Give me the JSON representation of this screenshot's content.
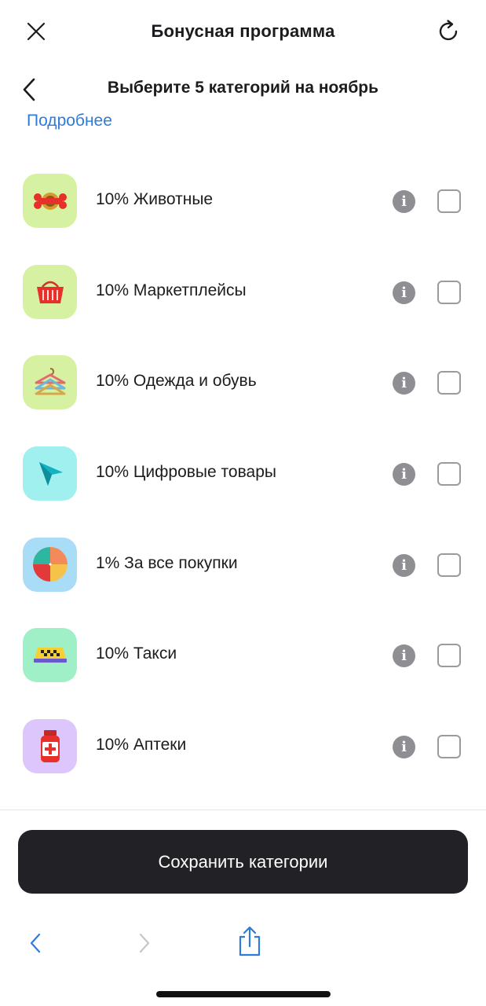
{
  "header": {
    "title": "Бонусная программа",
    "close_icon": "close-icon",
    "refresh_icon": "refresh-icon"
  },
  "sub_header": {
    "title": "Выберите 5 категорий на ноябрь",
    "back_icon": "chevron-left-icon"
  },
  "more_link": "Подробнее",
  "categories": [
    {
      "label": "10% Животные",
      "icon": "bone-icon",
      "tile_color": "#d6f1a2"
    },
    {
      "label": "10% Маркетплейсы",
      "icon": "basket-icon",
      "tile_color": "#d6f1a2"
    },
    {
      "label": "10% Одежда и обувь",
      "icon": "hangers-icon",
      "tile_color": "#d6f1a2"
    },
    {
      "label": "10% Цифровые товары",
      "icon": "cursor-arrow-icon",
      "tile_color": "#9ff0ee"
    },
    {
      "label": "1% За все покупки",
      "icon": "pie-chart-icon",
      "tile_color": "#a9dcf6"
    },
    {
      "label": "10% Такси",
      "icon": "taxi-sign-icon",
      "tile_color": "#9ff0c6"
    },
    {
      "label": "10% Аптеки",
      "icon": "medicine-jar-icon",
      "tile_color": "#dcc6fb"
    }
  ],
  "save_button": "Сохранить категории",
  "browser_bar": {
    "back_icon": "chevron-left-icon",
    "forward_icon": "chevron-right-icon",
    "share_icon": "share-icon"
  },
  "colors": {
    "accent_link": "#2f7bd9",
    "button_dark": "#222226",
    "info_gray": "#8e8e93"
  }
}
